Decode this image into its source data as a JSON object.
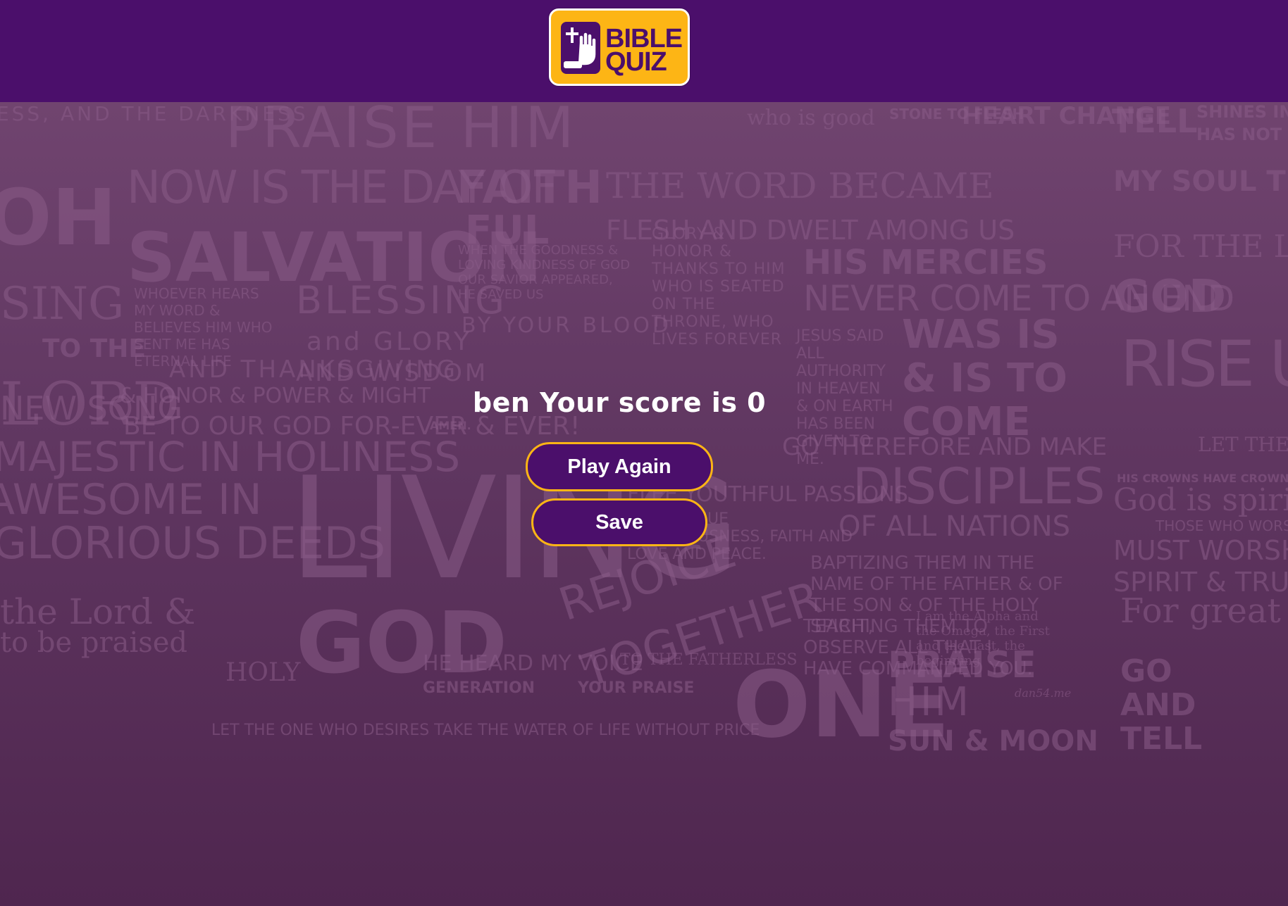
{
  "header": {
    "logo_line1": "BIBLE",
    "logo_line2": "QUIZ",
    "brand_color": "#4b0f6b",
    "accent_color": "#fdb515"
  },
  "background_words": [
    "NESS, AND THE DARKNESS",
    "PRAISE HIM",
    "who is good",
    "STONE TO FLESH",
    "HEART CHANGE",
    "TELL",
    "SHINES IN THE",
    "HAS NOT OVE",
    "NOW IS THE DAY OF",
    "SALVATION",
    "FAITH",
    "FUL",
    "THE WORD BECAME",
    "FLESH AND DWELT AMONG US",
    "MY SOUL THIRSTS FOR GOD,",
    "FOR THE Living",
    "GOD",
    "OH",
    "SING",
    "TO THE",
    "LORD",
    "HIS MERCIES",
    "NEVER COME TO AN END",
    "WHEN THE GOODNESS & LOVING KINDNESS OF GOD OUR SAVIOR APPEARED, HE SAVED US",
    "GLORY & HONOR & THANKS TO HIM WHO IS SEATED ON THE THRONE, WHO LIVES FOREVER",
    "WHOEVER HEARS MY WORD & BELIEVES HIM WHO SENT ME HAS ETERNAL LIFE",
    "BLESSING",
    "and GLORY",
    "AND WISDOM",
    "BY YOUR BLOOD",
    "JESUS SAID ALL AUTHORITY IN HEAVEN & ON EARTH HAS BEEN GIVEN TO ME.",
    "WAS IS & IS TO COME",
    "RISE UP",
    "NEW SONG",
    "AND THANKSGIVING",
    "& HONOR & POWER & MIGHT",
    "BE TO OUR GOD FOR-EVER & EVER!",
    "AMEN.",
    "HIS CROWNS HAVE CROWNS",
    "LET THE SEA ROAR",
    "GO THEREFORE AND MAKE",
    "DISCIPLES",
    "OF ALL NATIONS",
    "MAJESTIC IN HOLINESS",
    "AWESOME IN",
    "GLORIOUS DEEDS",
    "LIVING",
    "FLEE YOUTHFUL PASSIONS",
    "AND PURSUE RIGHTEOUSNESS, FAITH AND LOVE AND PEACE.",
    "BAPTIZING THEM IN THE NAME OF THE FATHER & OF THE SON & OF THE HOLY SPIRIT,",
    "TEACHING THEM TO OBSERVE ALL THAT I HAVE COMMANDED YOU.",
    "God is spirit",
    "THOSE WHO WORSHIP",
    "MUST WORSHIP",
    "SPIRIT & TRUTH",
    "REJOICE",
    "TOGETHER",
    "the Lord &",
    "to be praised",
    "GOD",
    "For great",
    "I am the Alpha and the Omega, the First and the Last, the beginning",
    "HOLY",
    "HE HEARD MY VOICE",
    "GENERATION",
    "YOUR PRAISE",
    "TO THE FATHERLESS",
    "ONE",
    "PRAISE",
    "HIM",
    "SUN & MOON",
    "GO AND TELL",
    "LET THE ONE WHO DESIRES TAKE THE WATER OF LIFE WITHOUT PRICE",
    "dan54.me"
  ],
  "result": {
    "player_name": "ben",
    "score_text": "ben Your score is 0"
  },
  "buttons": {
    "play_again": "Play Again",
    "save": "Save"
  }
}
